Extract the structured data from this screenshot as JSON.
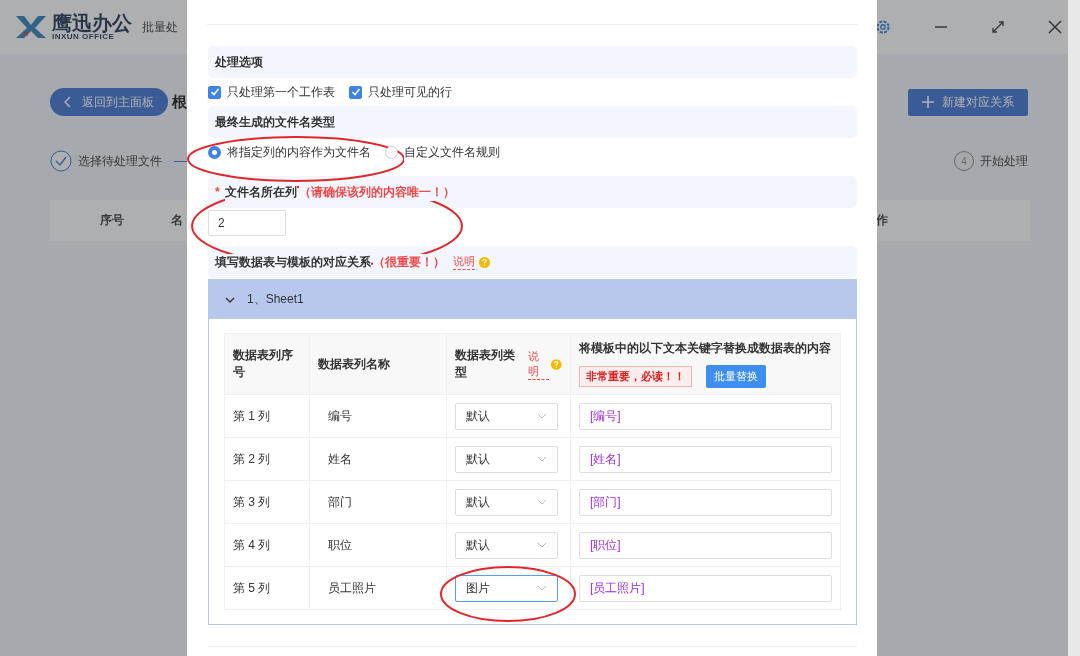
{
  "app": {
    "logo_title": "鹰迅办公",
    "logo_subtitle": "INXUN OFFICE",
    "title": "批量处",
    "back_button": "返回到主面板",
    "page_title": "根",
    "new_button": "新建对应关系",
    "steps": [
      {
        "label": "选择待处理文件",
        "done": true
      },
      {
        "number": "4",
        "label": "开始处理",
        "done": false
      }
    ],
    "table_columns": [
      "序号",
      "名",
      "作"
    ]
  },
  "dialog": {
    "options": {
      "title": "处理选项",
      "checkboxes": [
        {
          "label": "只处理第一个工作表",
          "checked": true
        },
        {
          "label": "只处理可见的行",
          "checked": true
        }
      ]
    },
    "filename_type": {
      "title": "最终生成的文件名类型",
      "radios": [
        {
          "label": "将指定列的内容作为文件名",
          "selected": true
        },
        {
          "label": "自定义文件名规则",
          "selected": false
        }
      ]
    },
    "filename_column": {
      "required_mark": "*",
      "label": "文件名所在列",
      "note": "（请确保该列的内容唯一！）",
      "value": "2"
    },
    "mapping": {
      "title": "填写数据表与模板的对应关系",
      "note": "（很重要！）",
      "help_link": "说明",
      "sheets": [
        {
          "label": "1、Sheet1",
          "expanded": true,
          "columns": [
            "数据表列序号",
            "数据表列名称",
            "数据表列类型",
            "将模板中的以下文本关键字替换成数据表的内容"
          ],
          "type_help": "说明",
          "warning": "非常重要，必读！！",
          "batch_button": "批量替换",
          "rows": [
            {
              "index": "第 1 列",
              "name": "编号",
              "type": "默认",
              "keyword": "[编号]",
              "focused": false
            },
            {
              "index": "第 2 列",
              "name": "姓名",
              "type": "默认",
              "keyword": "[姓名]",
              "focused": false
            },
            {
              "index": "第 3 列",
              "name": "部门",
              "type": "默认",
              "keyword": "[部门]",
              "focused": false
            },
            {
              "index": "第 4 列",
              "name": "职位",
              "type": "默认",
              "keyword": "[职位]",
              "focused": false
            },
            {
              "index": "第 5 列",
              "name": "员工照片",
              "type": "图片",
              "keyword": "[员工照片]",
              "focused": true
            }
          ]
        }
      ]
    }
  }
}
